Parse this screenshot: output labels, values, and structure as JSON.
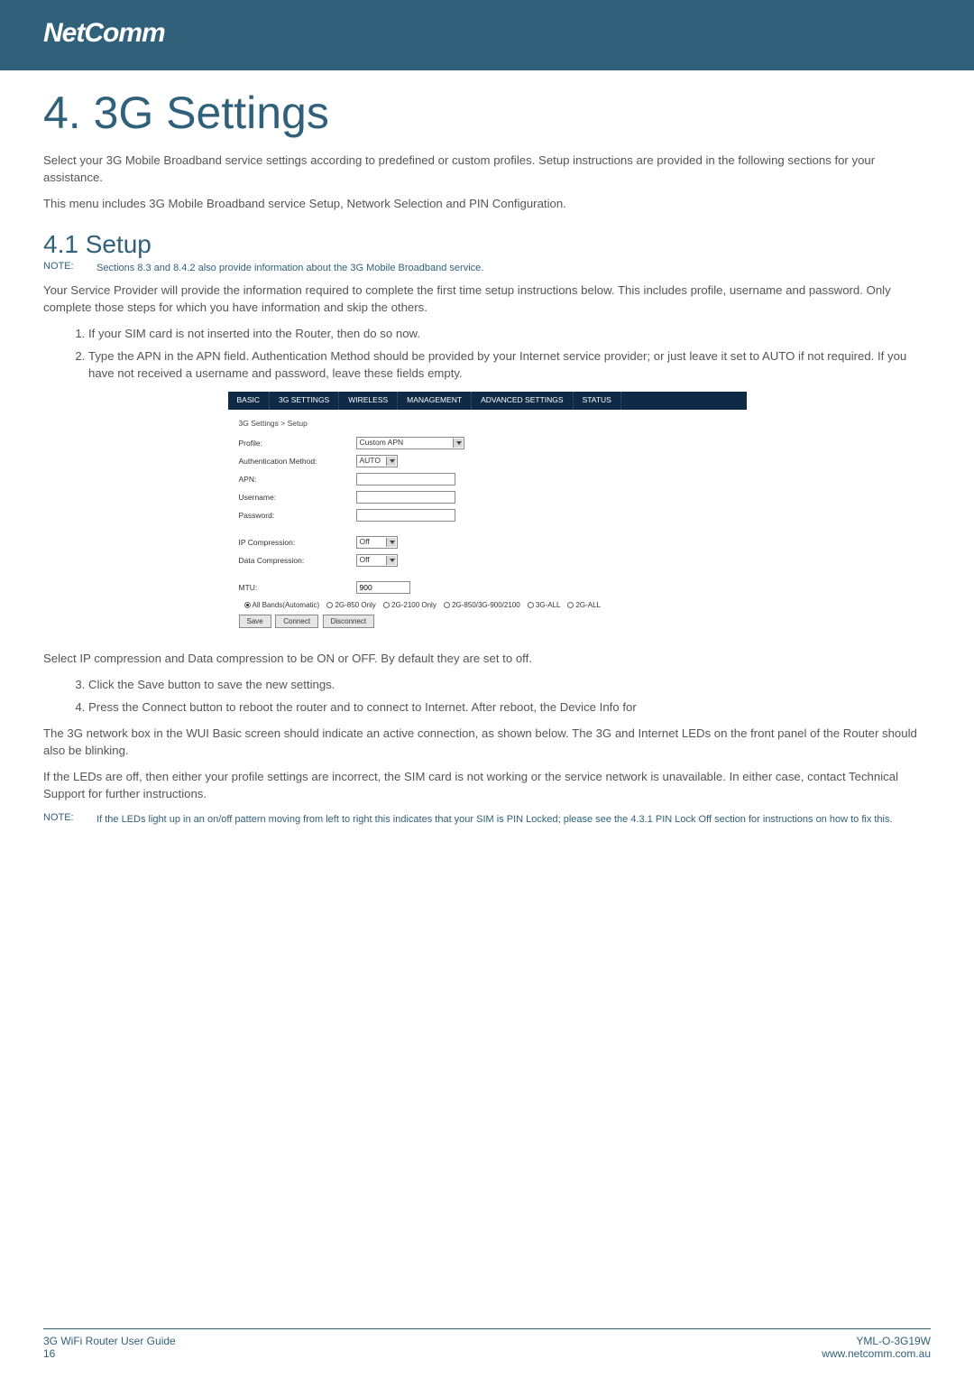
{
  "brand": "NetComm",
  "title": "4. 3G Settings",
  "intro1": "Select your 3G Mobile Broadband service settings according to predefined or custom profiles. Setup instructions are provided in the following sections for your assistance.",
  "intro2": "This menu includes 3G Mobile Broadband service Setup, Network Selection and PIN Configuration.",
  "section_heading": "4.1 Setup",
  "note1_label": "NOTE:",
  "note1_text": "Sections 8.3 and 8.4.2 also provide information about the 3G Mobile Broadband service.",
  "para1": "Your Service Provider will provide the information required to complete the first time setup instructions below. This includes profile, username and password. Only complete those steps for which you have information and skip the others.",
  "list1": [
    "If your SIM card is not inserted into the Router, then do so now.",
    "Type the APN in the APN field. Authentication Method should be provided by your Internet service provider; or just leave it set to AUTO if not required. If you have not received a username and password, leave these fields empty."
  ],
  "para2": "Select IP compression and Data compression to be ON or OFF. By default they are set to off.",
  "list2": [
    "Click the Save button to save the new settings.",
    "Press the Connect button to reboot the router and to connect to Internet. After reboot, the Device Info for"
  ],
  "para3": "The 3G network box in the WUI Basic screen should indicate an active connection, as shown below. The 3G and Internet LEDs on the front panel of the Router should also be blinking.",
  "para4": "If the LEDs are off, then either your profile settings are incorrect, the SIM card is not working or the service network is unavailable. In either case, contact Technical Support for further instructions.",
  "note2_label": "NOTE:",
  "note2_text": "If the LEDs light up in an on/off pattern moving from left to right this indicates that your SIM is PIN Locked; please see the 4.3.1 PIN Lock Off section for instructions on how to fix this.",
  "wui": {
    "tabs": [
      "BASIC",
      "3G SETTINGS",
      "WIRELESS",
      "MANAGEMENT",
      "ADVANCED SETTINGS",
      "STATUS"
    ],
    "breadcrumb": "3G Settings > Setup",
    "labels": {
      "profile": "Profile:",
      "auth": "Authentication Method:",
      "apn": "APN:",
      "user": "Username:",
      "pass": "Password:",
      "ipcomp": "IP Compression:",
      "datacomp": "Data Compression:",
      "mtu": "MTU:"
    },
    "values": {
      "profile": "Custom APN",
      "auth": "AUTO",
      "ipcomp": "Off",
      "datacomp": "Off",
      "mtu": "900"
    },
    "radios": [
      "All Bands(Automatic)",
      "2G-850 Only",
      "2G-2100 Only",
      "2G-850/3G-900/2100",
      "3G-ALL",
      "2G-ALL"
    ],
    "radio_checked_index": 0,
    "buttons": [
      "Save",
      "Connect",
      "Disconnect"
    ]
  },
  "footer": {
    "left1": "3G WiFi Router User Guide",
    "left2": "16",
    "right1": "YML-O-3G19W",
    "right2": "www.netcomm.com.au"
  }
}
